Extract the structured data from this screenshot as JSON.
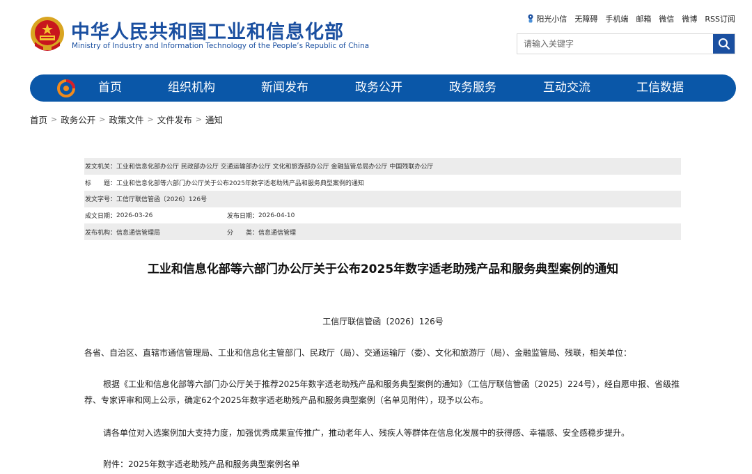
{
  "site": {
    "title_cn": "中华人民共和国工业和信息化部",
    "title_en": "Ministry of Industry and Information Technology of the People’s Republic of China"
  },
  "toplinks": {
    "sunshine": "阳光小信",
    "accessibility": "无障碍",
    "mobile": "手机端",
    "mail": "邮箱",
    "wechat": "微信",
    "weibo": "微博",
    "rss": "RSS订阅"
  },
  "search": {
    "placeholder": "请输入关键字"
  },
  "nav": {
    "items": [
      "首页",
      "组织机构",
      "新闻发布",
      "政务公开",
      "政务服务",
      "互动交流",
      "工信数据"
    ]
  },
  "breadcrumb": {
    "items": [
      "首页",
      "政务公开",
      "政策文件",
      "文件发布",
      "通知"
    ],
    "separator": ">"
  },
  "meta": {
    "issuer_label": "发文机关：",
    "issuer": "工业和信息化部办公厅 民政部办公厅 交通运输部办公厅 文化和旅游部办公厅 金融监管总局办公厅 中国残联办公厅",
    "title_label": "标　　题：",
    "title": "工业和信息化部等六部门办公厅关于公布2025年数字适老助残产品和服务典型案例的通知",
    "docno_label": "发文字号：",
    "docno": "工信厅联信管函〔2026〕126号",
    "created_label": "成文日期：",
    "created": "2026-03-26",
    "published_label": "发布日期：",
    "published": "2026-04-10",
    "org_label": "发布机构：",
    "org": "信息通信管理局",
    "category_label": "分　　类：",
    "category": "信息通信管理"
  },
  "article": {
    "title": "工业和信息化部等六部门办公厅关于公布2025年数字适老助残产品和服务典型案例的通知",
    "doc_no": "工信厅联信管函〔2026〕126号",
    "recipients": "各省、自治区、直辖市通信管理局、工业和信息化主管部门、民政厅（局）、交通运输厅（委）、文化和旅游厅（局）、金融监管局、残联，相关单位：",
    "para1": "根据《工业和信息化部等六部门办公厅关于推荐2025年数字适老助残产品和服务典型案例的通知》（工信厅联信管函〔2025〕224号），经自愿申报、省级推荐、专家评审和网上公示，确定62个2025年数字适老助残产品和服务典型案例（名单见附件），现予以公布。",
    "para2": "请各单位对入选案例加大支持力度，加强优秀成果宣传推广，推动老年人、残疾人等群体在信息化发展中的获得感、幸福感、安全感稳步提升。",
    "attachment": "附件：2025年数字适老助残产品和服务典型案例名单"
  },
  "colors": {
    "brand_blue": "#1a4fa0",
    "nav_blue": "#0a57a8",
    "meta_shade": "#ececec"
  }
}
